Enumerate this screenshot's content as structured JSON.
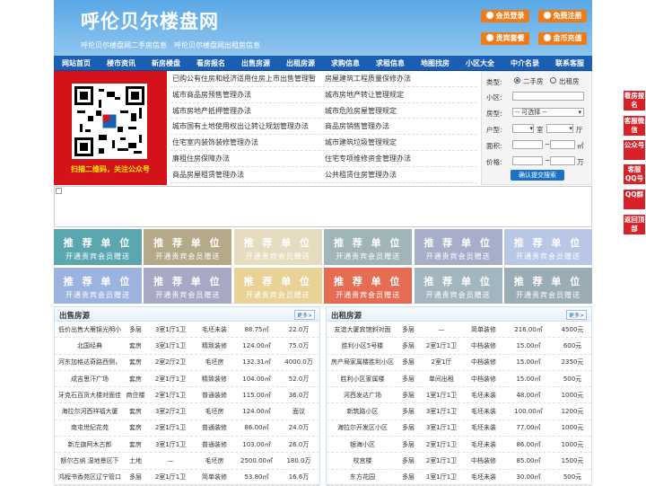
{
  "header": {
    "logo": "呼伦贝尔楼盘网",
    "sub1": "呼伦贝尔楼盘网二手房信息",
    "sub2": "呼伦贝尔楼盘网出租房信息",
    "buttons": [
      "会员登录",
      "免费注册",
      "贵宾套餐",
      "金币充值"
    ]
  },
  "nav": [
    "网站首页",
    "楼市资讯",
    "新房楼盘",
    "看房报名",
    "出售房源",
    "出租房源",
    "求购信息",
    "求租信息",
    "地图找房",
    "小区大全",
    "中介名录",
    "联系客服"
  ],
  "qr": {
    "caption": "扫描二维码，关注公众号"
  },
  "links": [
    [
      "已购公有住房和经济适用住房上市出售管理暂",
      "房屋建筑工程质量保修办法"
    ],
    [
      "城市商品房预售管理办法",
      "城市房地产转让管理规定"
    ],
    [
      "城市房地产抵押管理办法",
      "城市危险房屋管理规定"
    ],
    [
      "城市国有土地使用权出让转让规划管理办法",
      "商品房销售管理办法"
    ],
    [
      "住宅室内装饰装修管理办法",
      "城市建筑垃圾管理规定"
    ],
    [
      "廉租住房保障办法",
      "住宅专项维修资金管理办法"
    ],
    [
      "商品房屋租赁管理办法",
      "公共租赁住房管理办法"
    ]
  ],
  "search": {
    "type_label": "类型:",
    "opt1": "二手房",
    "opt2": "出租房",
    "community_label": "小区:",
    "house_label": "房型:",
    "house_select": "-- 可选择 --",
    "layout_label": "户型:",
    "room": "室",
    "hall": "厅",
    "area_label": "面积:",
    "area_unit": "㎡",
    "price_label": "价格:",
    "price_unit": "万",
    "submit": "确认提交搜索"
  },
  "promo": {
    "line1": "推 荐 单 位",
    "line2": "开通贵宾会员赠送"
  },
  "promo_colors": [
    "#5aa7b0",
    "#b5a98a",
    "#e8dcc0",
    "#9fb5b8",
    "#a6aec9",
    "#b8c7e6",
    "#9cb3e0",
    "#a7a8c4",
    "#e8d296",
    "#e56c52",
    "#a3b6c0",
    "#9aacb4"
  ],
  "sale": {
    "title": "出售房源",
    "more": "更多>",
    "rows": [
      [
        "低价出售大雁锦光明小",
        "多层",
        "3室1厅1卫",
        "毛坯未装",
        "88.75㎡",
        "22.0万"
      ],
      [
        "北国经典",
        "套房",
        "3室1厅1卫",
        "精致装修",
        "124.00㎡",
        "75.0万"
      ],
      [
        "河东加格达奇路西侧，",
        "套房",
        "2室2厅2卫",
        "毛坯房",
        "132.31㎡",
        "4000.0万"
      ],
      [
        "成吉思汗广场",
        "套房",
        "2室1厅1卫",
        "精致装修",
        "104.00㎡",
        "52.0万"
      ],
      [
        "牙克石百货大楼对面佳",
        "商住楼",
        "2室1厅1卫",
        "普通装修",
        "115.00㎡",
        "36.0万"
      ],
      [
        "海拉尔河西祥福大厦",
        "套房",
        "3室2厅2卫",
        "毛坯房",
        "124.00㎡",
        "面议"
      ],
      [
        "南屯世纪花苑",
        "套房",
        "2室1厅1卫",
        "普通装修",
        "86.00㎡",
        "24.0万"
      ],
      [
        "新左旗阿木古郎",
        "套房",
        "3室1厅1卫",
        "普通装修",
        "103.00㎡",
        "26.0万"
      ],
      [
        "额尔古纳 湿地景区下",
        "土地",
        "—",
        "毛坯房",
        "2500.00㎡",
        "180.0万"
      ],
      [
        "鸿程书香苑区辽宁管口",
        "多层",
        "2室1厅1卫",
        "简单装修",
        "53.80㎡",
        "16.6万"
      ]
    ]
  },
  "rent": {
    "title": "出租房源",
    "more": "更多>",
    "rows": [
      [
        "友谊大厦宾馆斜对面",
        "多层",
        "—",
        "简单装修",
        "216.00㎡",
        "4500元"
      ],
      [
        "胜利小区5号楼",
        "多层",
        "2室1厅1卫",
        "中档装修",
        "15.00㎡",
        "600元"
      ],
      [
        "房产局家属楼胜利小区",
        "多层",
        "2室1厅",
        "中档装修",
        "15.00㎡",
        "2350元"
      ],
      [
        "胜利小区家属楼",
        "多层",
        "单间出租",
        "中档装修",
        "15.00㎡",
        "500元"
      ],
      [
        "河西发达广场",
        "多层",
        "1室1厅1卫",
        "毛坯未装",
        "48.00㎡",
        "1000元"
      ],
      [
        "新筑路小区",
        "多层",
        "3室1厅1卫",
        "毛坯未装",
        "100.00㎡",
        "1200元"
      ],
      [
        "海拉尔开发区小区",
        "多层",
        "3室1厅1卫",
        "毛坯未装",
        "77.00㎡",
        "1000元"
      ],
      [
        "银海小区",
        "多层",
        "2室1厅1卫",
        "毛坯未装",
        "86.00㎡",
        "1000元"
      ],
      [
        "校宫楼",
        "多层",
        "2室1厅1卫",
        "中档装修",
        "85.00㎡",
        "1500元"
      ],
      [
        "东方花园",
        "多层",
        "1室1厅1卫",
        "毛坯未装",
        "30.00㎡",
        "500元"
      ]
    ]
  },
  "side": [
    "看房报名",
    "客服微信",
    "公众号",
    "客服QQ号",
    "QQ群",
    "返回顶部"
  ],
  "colors": {
    "nav": "#1a5fb4",
    "orange": "#f07c18",
    "red": "#d72027"
  }
}
